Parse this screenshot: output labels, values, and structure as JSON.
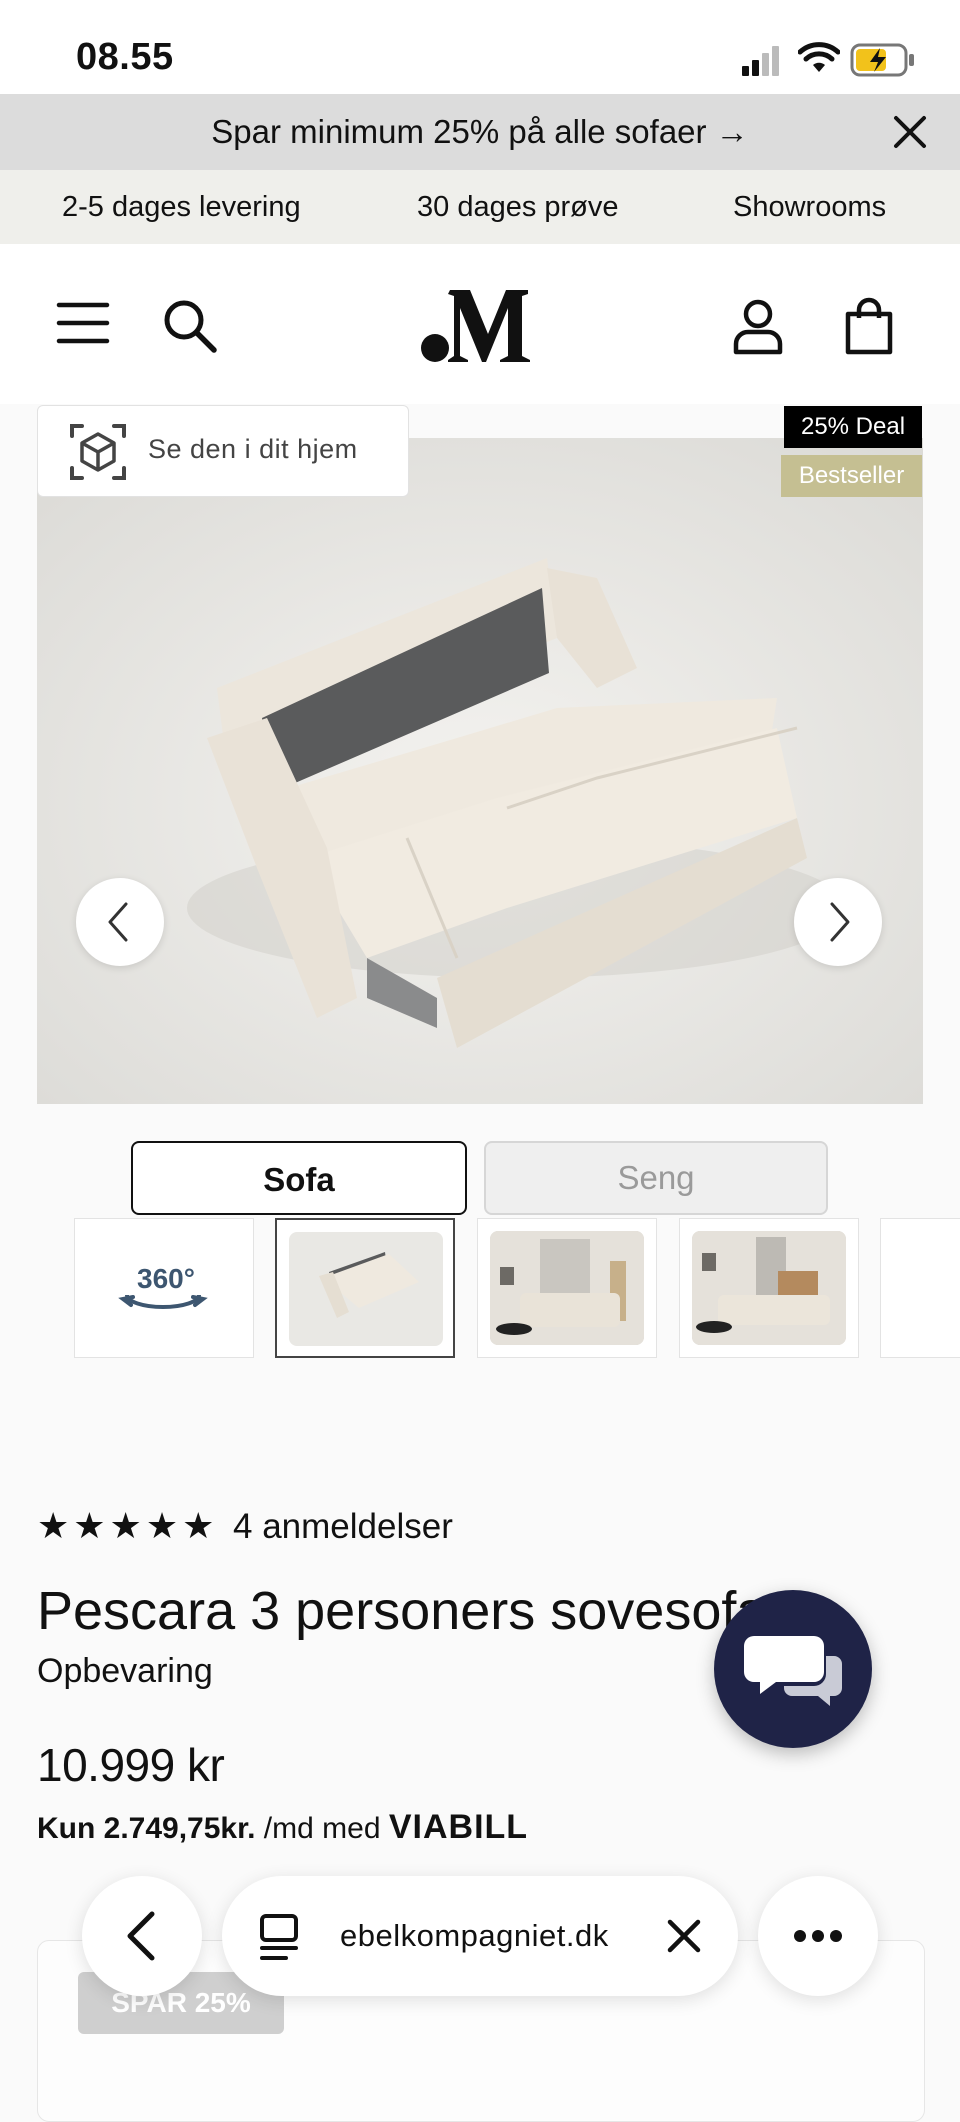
{
  "status_bar": {
    "time": "08.55"
  },
  "promo": {
    "text": "Spar minimum 25% på alle sofaer →"
  },
  "usp": {
    "items": [
      "2-5 dages levering",
      "30 dages prøve",
      "Showrooms"
    ]
  },
  "header": {
    "logo": ".M"
  },
  "gallery": {
    "ar_label": "Se den i dit hjem",
    "badges": [
      "25% Deal",
      "Bestseller"
    ],
    "toggle": [
      "Sofa",
      "Seng"
    ],
    "thumb_360": "360°"
  },
  "product": {
    "stars": "★★★★★",
    "reviews": "4 anmeldelser",
    "title": "Pescara 3 personers sovesofa",
    "subtitle": "Opbevaring",
    "price": "10.999 kr",
    "installment_bold": "Kun 2.749,75kr.",
    "installment_rest": " /md med ",
    "provider": "VIABILL"
  },
  "card": {
    "badge": "SPAR 25%"
  },
  "browser": {
    "url": "ebelkompagniet.dk"
  }
}
